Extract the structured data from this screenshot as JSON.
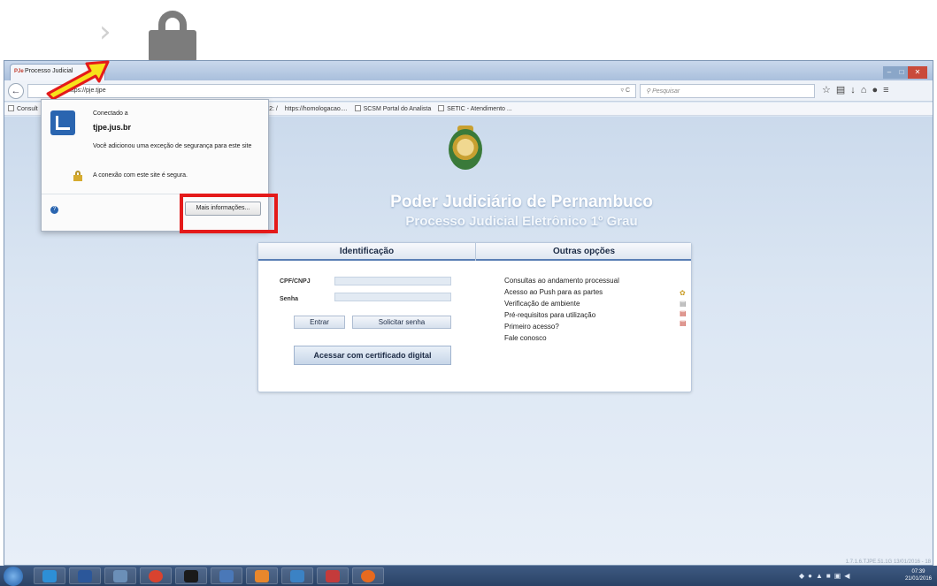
{
  "browser": {
    "tab_title": "Processo Judicial",
    "tab_icon_text": "PJe",
    "url_text": "https://pje.tjpe",
    "search_placeholder": "Pesquisar",
    "reload_text": "▿ C"
  },
  "bookmarks": [
    {
      "label": "Consult"
    },
    {
      "label": "on 1512: /"
    },
    {
      "label": "https://homologacao...."
    },
    {
      "label": "SCSM Portal do Analista"
    },
    {
      "label": "SETIC - Atendimento ..."
    }
  ],
  "identity_popup": {
    "connected_label": "Conectado a",
    "domain": "tjpe.jus.br",
    "exception_text": "Você adicionou uma exceção de segurança para este site",
    "secure_text": "A conexão com este site é segura.",
    "more_info_button": "Mais informações..."
  },
  "page": {
    "title": "Poder Judiciário de Pernambuco",
    "subtitle": "Processo Judicial Eletrônico 1º Grau",
    "status_line": "1.7.1.6.TJPE.51.1G 13/01/2016 - 18"
  },
  "login": {
    "heading_left": "Identificação",
    "heading_right": "Outras opções",
    "cpf_label": "CPF/CNPJ",
    "password_label": "Senha",
    "enter_button": "Entrar",
    "request_password_button": "Solicitar senha",
    "certificate_button": "Acessar com certificado digital"
  },
  "other_options": [
    {
      "label": "Consultas ao andamento processual"
    },
    {
      "label": "Acesso ao Push para as partes"
    },
    {
      "label": "Verificação de ambiente"
    },
    {
      "label": "Pré-requisitos para utilização"
    },
    {
      "label": "Primeiro acesso?"
    },
    {
      "label": "Fale conosco"
    }
  ],
  "taskbar": {
    "time": "07:39",
    "date": "21/01/2016"
  },
  "colors": {
    "highlight": "#e41a1a",
    "accent": "#5a7fb5",
    "arrow_fill": "#f7e21a"
  }
}
